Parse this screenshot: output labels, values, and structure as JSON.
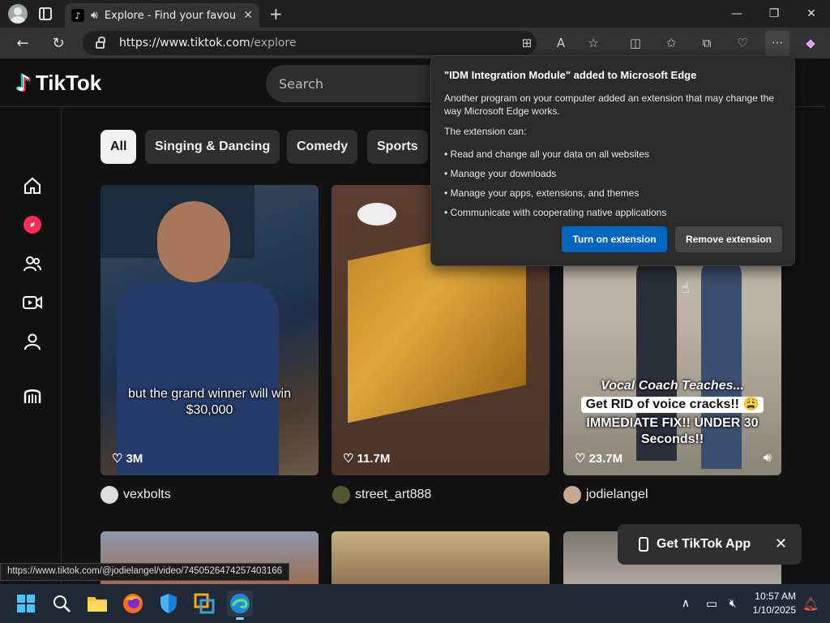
{
  "browser": {
    "tab_title": "Explore - Find your favourite",
    "tab_favicon": "♪",
    "url_host": "https://www.tiktok.com",
    "url_path": "/explore",
    "status_url": "https://www.tiktok.com/@jodielangel/video/7450526474257403166"
  },
  "tiktok": {
    "logo_text": "TikTok",
    "search_placeholder": "Search",
    "chips": [
      "All",
      "Singing & Dancing",
      "Comedy",
      "Sports"
    ],
    "videos": [
      {
        "count": "3M",
        "author": "vexbolts",
        "caption_lines": [
          "but the grand winner will win",
          "$30,000"
        ]
      },
      {
        "count": "11.7M",
        "author": "street_art888",
        "caption_lines": []
      },
      {
        "count": "23.7M",
        "author": "jodielangel",
        "caption_lines": [
          "Vocal Coach Teaches...",
          "Get RID of voice cracks!! 😩",
          "IMMEDIATE FIX!! UNDER 30",
          "Seconds!!"
        ]
      }
    ],
    "get_app_label": "Get TikTok App"
  },
  "popup": {
    "title": "\"IDM Integration Module\" added to Microsoft Edge",
    "text1": "Another program on your computer added an extension that may change the way Microsoft Edge works.",
    "text2": "The extension can:",
    "items": [
      "• Read and change all your data on all websites",
      "• Manage your downloads",
      "• Manage your apps, extensions, and themes",
      "• Communicate with cooperating native applications"
    ],
    "btn_primary": "Turn on extension",
    "btn_secondary": "Remove extension"
  },
  "taskbar": {
    "time": "10:57 AM",
    "date": "1/10/2025"
  },
  "colors": {
    "edge_blue": "#0067c0",
    "tiktok_red": "#fe2c55",
    "tiktok_cyan": "#25f4ee"
  }
}
